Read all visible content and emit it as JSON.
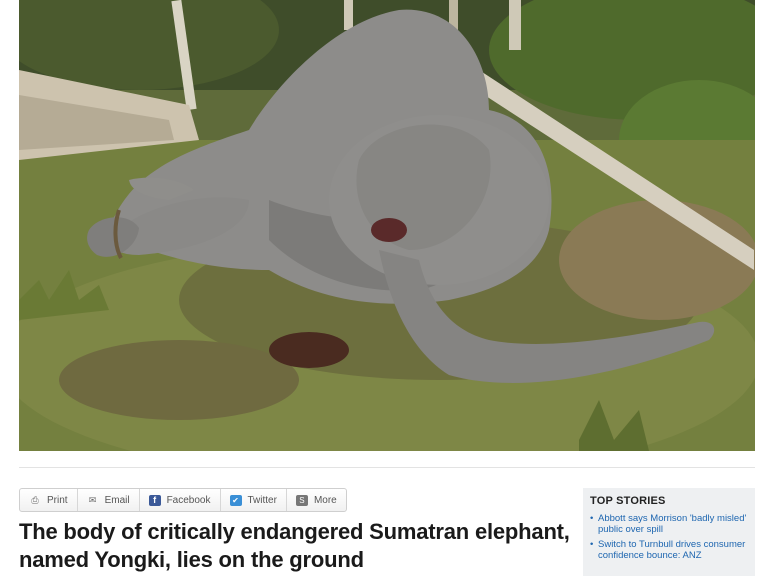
{
  "photo": {
    "icon": "photo",
    "colors": {
      "grass": "#6e7b45",
      "elephant": "#8d8c8a",
      "trunk_bark": "#d8d0bd"
    }
  },
  "share_bar": {
    "buttons": [
      {
        "label": "Print",
        "icon": "printer-icon"
      },
      {
        "label": "Email",
        "icon": "envelope-icon"
      },
      {
        "label": "Facebook",
        "icon": "facebook-icon"
      },
      {
        "label": "Twitter",
        "icon": "twitter-icon"
      },
      {
        "label": "More",
        "icon": "share-icon"
      }
    ]
  },
  "caption": {
    "headline": "The body of critically endangered Sumatran elephant, named Yongki, lies on the ground"
  },
  "top_stories": {
    "title": "TOP STORIES",
    "items": [
      {
        "text": "Abbott says Morrison 'badly misled' public over spill"
      },
      {
        "text": "Switch to Turnbull drives consumer confidence bounce: ANZ"
      }
    ]
  },
  "colors": {
    "link": "#1e66b0",
    "facebook": "#3b5998",
    "twitter": "#3a8fd6",
    "panel_bg": "#eef0f2"
  }
}
